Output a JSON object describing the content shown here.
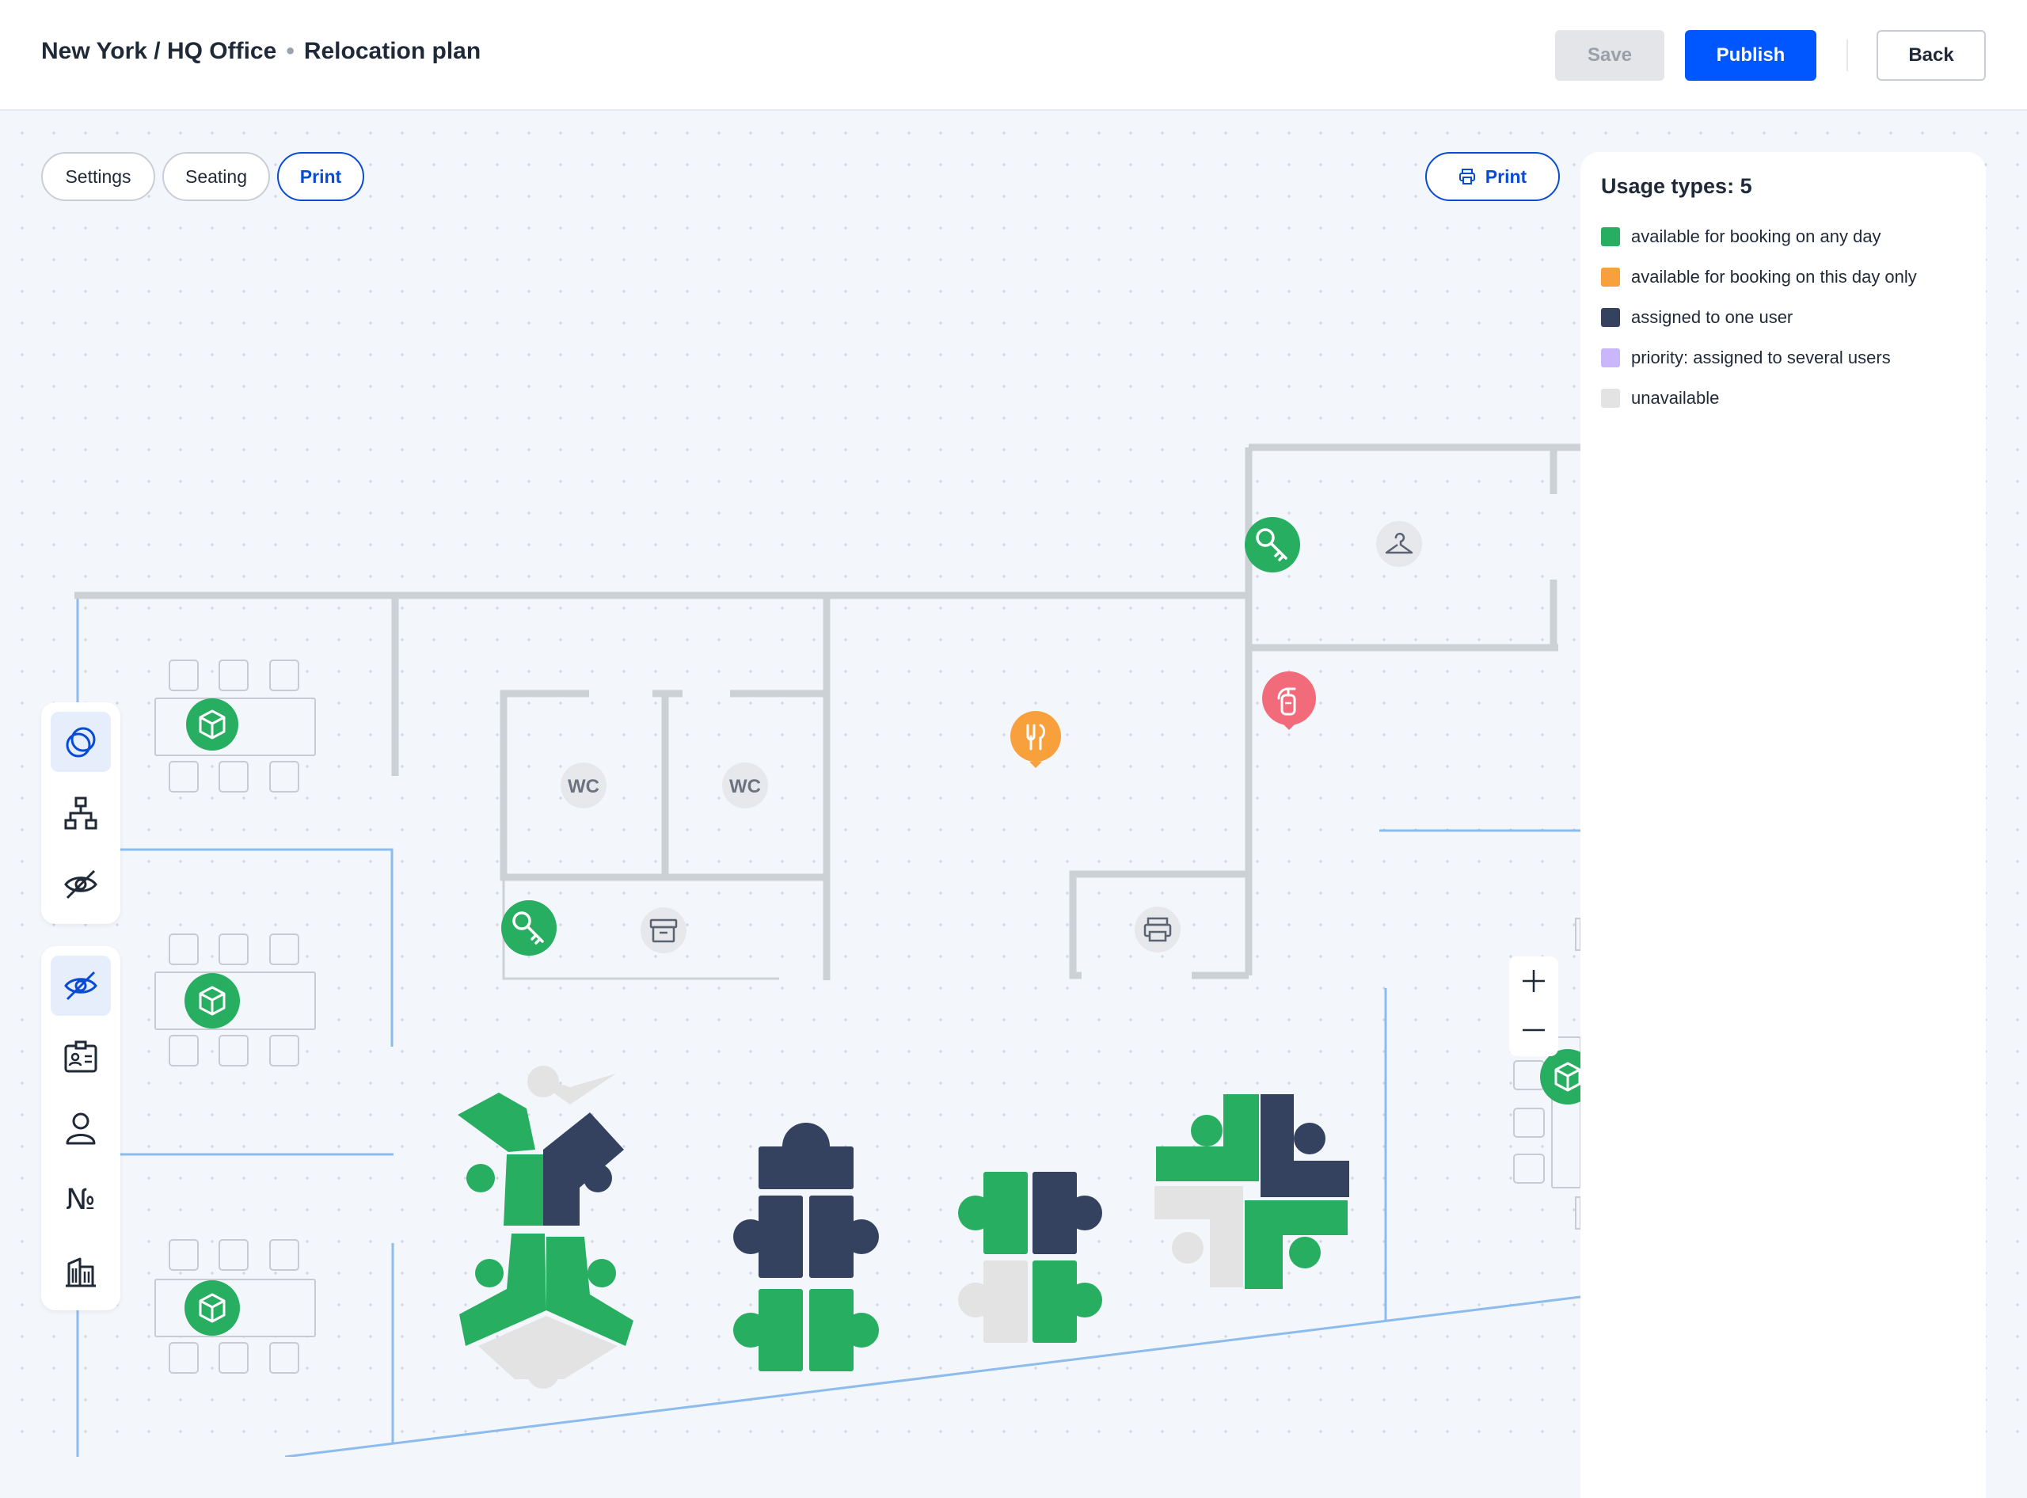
{
  "header": {
    "location": "New York / HQ Office",
    "separator": "•",
    "plan_title": "Relocation plan",
    "save_label": "Save",
    "publish_label": "Publish",
    "back_label": "Back"
  },
  "tabs": [
    {
      "label": "Settings",
      "active": false
    },
    {
      "label": "Seating",
      "active": false
    },
    {
      "label": "Print",
      "active": true
    }
  ],
  "print_button": {
    "label": "Print",
    "icon": "printer-icon"
  },
  "legend": {
    "title": "Usage types: 5",
    "items": [
      {
        "label": "available for booking on any day",
        "color": "#27ae60"
      },
      {
        "label": "available for booking on this day only",
        "color": "#f7a03c"
      },
      {
        "label": "assigned to one user",
        "color": "#34425f"
      },
      {
        "label": "priority: assigned to several users",
        "color": "#c9b6fb"
      },
      {
        "label": "unavailable",
        "color": "#e3e3e3"
      }
    ]
  },
  "toolbar": {
    "group1": [
      "overlap-icon",
      "hierarchy-icon",
      "hide-icon"
    ],
    "group2": [
      "hide-icon",
      "badge-icon",
      "person-icon",
      "number-icon",
      "building-icon"
    ],
    "number_symbol": "№"
  },
  "floorplan": {
    "wc_label": "WC",
    "markers": [
      "key-icon",
      "hanger-icon",
      "fire-extinguisher-icon",
      "dining-icon",
      "archive-icon",
      "printer-icon",
      "meeting-room-icon"
    ]
  },
  "zoom": {
    "in_label": "+",
    "out_label": "−"
  }
}
